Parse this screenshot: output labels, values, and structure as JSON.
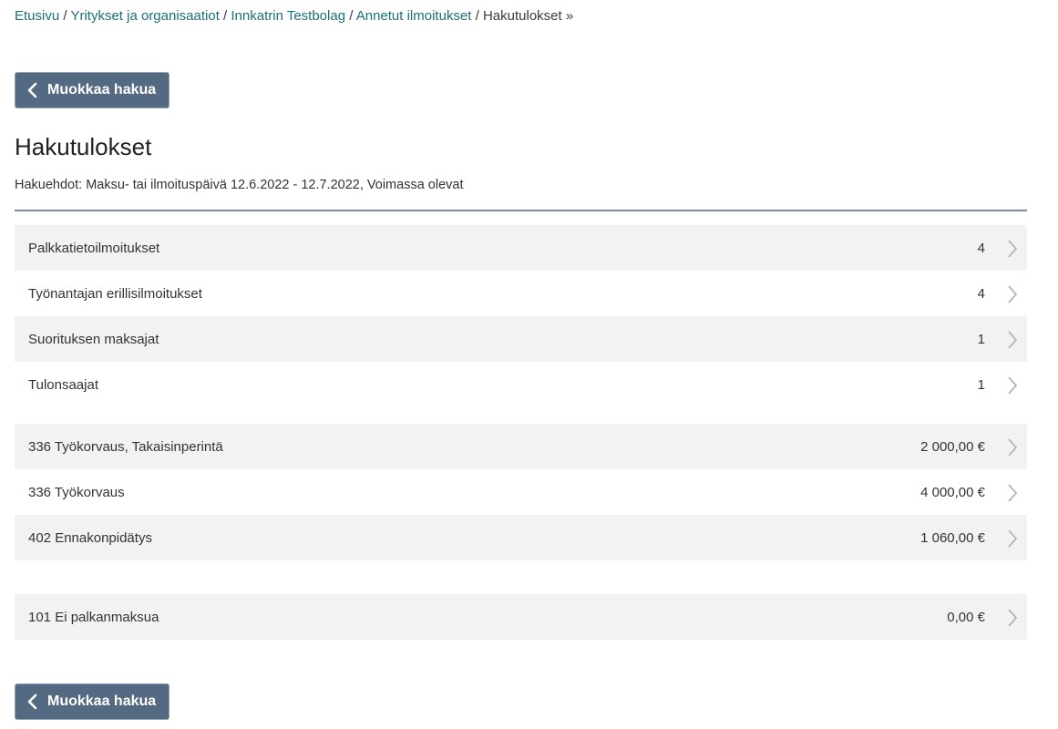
{
  "breadcrumb": {
    "items": [
      {
        "label": "Etusivu"
      },
      {
        "label": "Yritykset ja organisaatiot"
      },
      {
        "label": "Innkatrin Testbolag"
      },
      {
        "label": "Annetut ilmoitukset"
      }
    ],
    "separator": "/",
    "current": "Hakutulokset »"
  },
  "buttons": {
    "edit_search_label": "Muokkaa hakua"
  },
  "page": {
    "title": "Hakutulokset",
    "criteria": "Hakuehdot: Maksu- tai ilmoituspäivä 12.6.2022 - 12.7.2022, Voimassa olevat"
  },
  "groups": [
    {
      "rows": [
        {
          "label": "Palkkatietoilmoitukset",
          "value": "4"
        },
        {
          "label": "Työnantajan erillisilmoitukset",
          "value": "4"
        },
        {
          "label": "Suorituksen maksajat",
          "value": "1"
        },
        {
          "label": "Tulonsaajat",
          "value": "1"
        }
      ]
    },
    {
      "rows": [
        {
          "label": "336 Työkorvaus, Takaisinperintä",
          "value": "2 000,00 €"
        },
        {
          "label": "336 Työkorvaus",
          "value": "4 000,00 €"
        },
        {
          "label": "402 Ennakonpidätys",
          "value": "1 060,00 €"
        }
      ]
    },
    {
      "rows": [
        {
          "label": "101 Ei palkanmaksua",
          "value": "0,00 €"
        }
      ]
    }
  ],
  "icons": {
    "back": "chevron-left-icon",
    "row_arrow": "chevron-right-icon"
  },
  "colors": {
    "link": "#1a6f7a",
    "button_bg": "#546a82",
    "row_shade": "#f2f2f2",
    "arrow": "#b5b5b5"
  }
}
